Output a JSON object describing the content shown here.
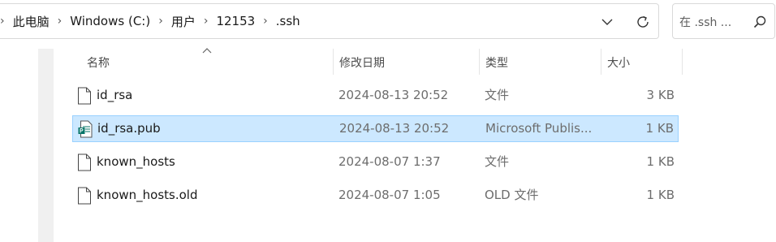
{
  "breadcrumb": [
    "此电脑",
    "Windows (C:)",
    "用户",
    "12153",
    ".ssh"
  ],
  "search": {
    "placeholder": "在 .ssh ..."
  },
  "columns": {
    "name": "名称",
    "date": "修改日期",
    "type": "类型",
    "size": "大小"
  },
  "files": [
    {
      "name": "id_rsa",
      "date": "2024-08-13  20:52",
      "type": "文件",
      "size": "3 KB",
      "icon": "file-icon",
      "selected": false
    },
    {
      "name": "id_rsa.pub",
      "date": "2024-08-13  20:52",
      "type": "Microsoft Publis...",
      "size": "1 KB",
      "icon": "publisher-file-icon",
      "selected": true
    },
    {
      "name": "known_hosts",
      "date": "2024-08-07  1:37",
      "type": "文件",
      "size": "1 KB",
      "icon": "file-icon",
      "selected": false
    },
    {
      "name": "known_hosts.old",
      "date": "2024-08-07  1:05",
      "type": "OLD 文件",
      "size": "1 KB",
      "icon": "file-icon",
      "selected": false
    }
  ],
  "colors": {
    "selection_bg": "#cce8ff",
    "selection_border": "#99d1ff",
    "publisher_green": "#077568"
  }
}
